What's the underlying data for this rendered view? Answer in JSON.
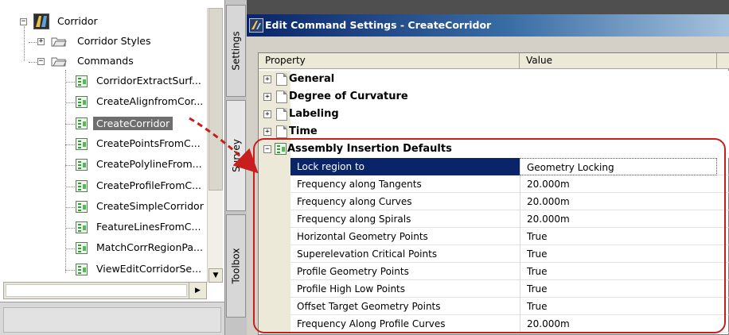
{
  "tree": {
    "root_label": "Corridor",
    "items": [
      {
        "label": "Corridor Styles"
      },
      {
        "label": "Commands"
      }
    ],
    "commands": [
      {
        "label": "CorridorExtractSurf..."
      },
      {
        "label": "CreateAlignfromCor..."
      },
      {
        "label": "CreateCorridor"
      },
      {
        "label": "CreatePointsFromC..."
      },
      {
        "label": "CreatePolylineFrom..."
      },
      {
        "label": "CreateProfileFromC..."
      },
      {
        "label": "CreateSimpleCorridor"
      },
      {
        "label": "FeatureLinesFromC..."
      },
      {
        "label": "MatchCorrRegionPa..."
      },
      {
        "label": "ViewEditCorridorSe..."
      }
    ],
    "selected_index": 2
  },
  "tabs": {
    "settings": "Settings",
    "survey": "Survey",
    "toolbox": "Toolbox"
  },
  "dialog": {
    "title": "Edit Command Settings - CreateCorridor",
    "header": {
      "property": "Property",
      "value": "Value"
    },
    "categories": [
      {
        "label": "General",
        "expand": "+"
      },
      {
        "label": "Degree of Curvature",
        "expand": "+"
      },
      {
        "label": "Labeling",
        "expand": "+"
      },
      {
        "label": "Time",
        "expand": "+"
      },
      {
        "label": "Assembly Insertion Defaults",
        "expand": "−"
      }
    ],
    "properties": [
      {
        "name": "Lock region to",
        "value": "Geometry Locking"
      },
      {
        "name": "Frequency along Tangents",
        "value": "20.000m"
      },
      {
        "name": "Frequency along Curves",
        "value": "20.000m"
      },
      {
        "name": "Frequency along Spirals",
        "value": "20.000m"
      },
      {
        "name": "Horizontal Geometry Points",
        "value": "True"
      },
      {
        "name": "Superelevation Critical Points",
        "value": "True"
      },
      {
        "name": "Profile Geometry Points",
        "value": "True"
      },
      {
        "name": "Profile High Low Points",
        "value": "True"
      },
      {
        "name": "Offset Target Geometry Points",
        "value": "True"
      },
      {
        "name": "Frequency Along Profile Curves",
        "value": "20.000m"
      }
    ]
  },
  "colors": {
    "annotation_red": "#c81e1e",
    "selection_blue": "#0a246a",
    "tree_selection": "#6e6e6e"
  },
  "icons": {
    "tree_root": "corridor-icon",
    "folder": "folder-icon",
    "command": "command-check-icon",
    "category": "page-icon",
    "assembly": "check-grid-icon"
  }
}
